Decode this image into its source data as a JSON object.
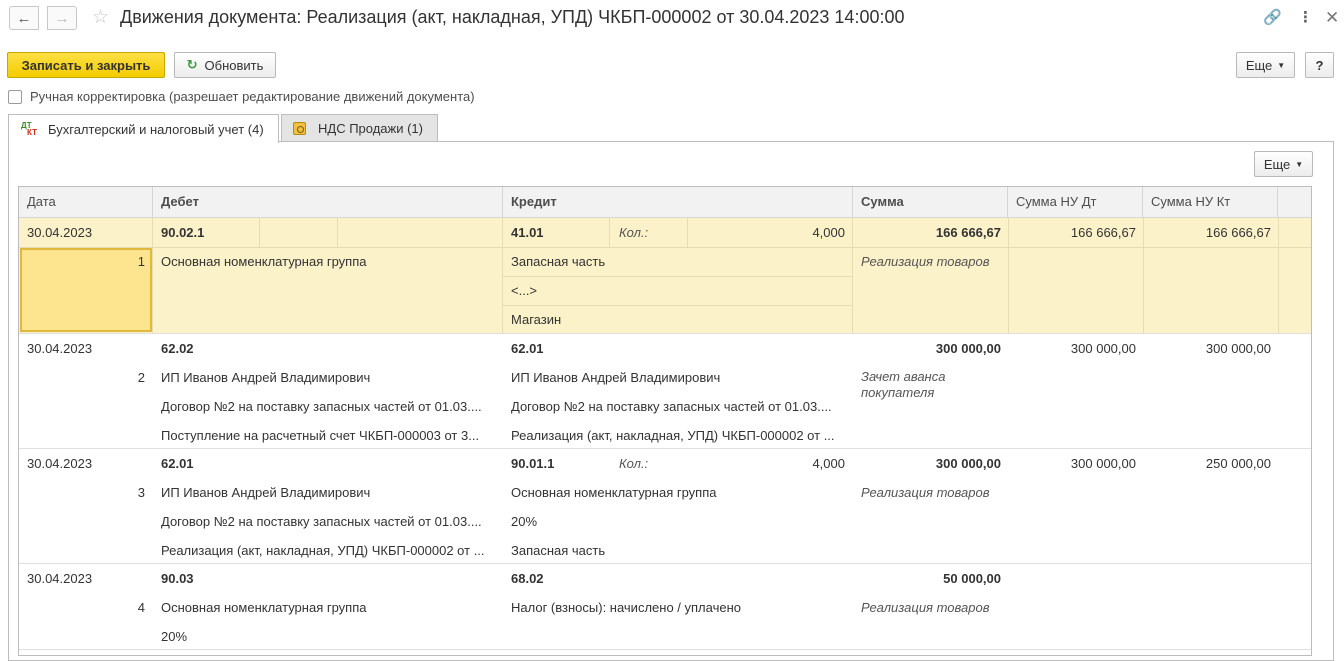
{
  "window": {
    "title": "Движения документа: Реализация (акт, накладная, УПД) ЧКБП-000002 от 30.04.2023 14:00:00",
    "back_icon": "arrow-left-icon",
    "forward_icon": "arrow-right-icon",
    "favorite_icon": "star-icon",
    "link_icon": "link-icon",
    "menu_icon": "kebab-menu-icon",
    "close_icon": "close-icon"
  },
  "toolbar": {
    "save_close_label": "Записать и закрыть",
    "refresh_label": "Обновить",
    "more_label": "Еще",
    "help_label": "?",
    "accent_color": "#f4cc00"
  },
  "manual_checkbox": {
    "label": "Ручная корректировка (разрешает редактирование движений документа)",
    "checked": false
  },
  "tabs": [
    {
      "label": "Бухгалтерский и налоговый учет (4)",
      "active": true,
      "icon": "dt-kt-icon"
    },
    {
      "label": "НДС Продажи (1)",
      "active": false,
      "icon": "vat-register-icon"
    }
  ],
  "panel": {
    "more_label": "Еще"
  },
  "table": {
    "headers": {
      "date": "Дата",
      "debit": "Дебет",
      "credit": "Кредит",
      "sum": "Сумма",
      "sum_nu_dt": "Сумма НУ Дт",
      "sum_nu_kt": "Сумма НУ Кт"
    },
    "records": [
      {
        "date": "30.04.2023",
        "num": "1",
        "debit_account": "90.02.1",
        "debit_lines": [
          "Основная номенклатурная группа",
          "",
          ""
        ],
        "credit_account": "41.01",
        "credit_qty_label": "Кол.:",
        "credit_qty": "4,000",
        "credit_lines": [
          "Запасная часть",
          "<...>",
          "Магазин"
        ],
        "sum": "166 666,67",
        "content": "Реализация товаров",
        "sum_nu_dt": "166 666,67",
        "sum_nu_kt": "166 666,67"
      },
      {
        "date": "30.04.2023",
        "num": "2",
        "debit_account": "62.02",
        "debit_lines": [
          "ИП Иванов Андрей Владимирович",
          "Договор №2 на поставку запасных частей от 01.03....",
          "Поступление на расчетный счет ЧКБП-000003 от 3..."
        ],
        "credit_account": "62.01",
        "credit_qty_label": "",
        "credit_qty": "",
        "credit_lines": [
          "ИП Иванов Андрей Владимирович",
          "Договор №2 на поставку запасных частей от 01.03....",
          "Реализация (акт, накладная, УПД) ЧКБП-000002 от ..."
        ],
        "sum": "300 000,00",
        "content": "Зачет аванса покупателя",
        "sum_nu_dt": "300 000,00",
        "sum_nu_kt": "300 000,00"
      },
      {
        "date": "30.04.2023",
        "num": "3",
        "debit_account": "62.01",
        "debit_lines": [
          "ИП Иванов Андрей Владимирович",
          "Договор №2 на поставку запасных частей от 01.03....",
          "Реализация (акт, накладная, УПД) ЧКБП-000002 от ..."
        ],
        "credit_account": "90.01.1",
        "credit_qty_label": "Кол.:",
        "credit_qty": "4,000",
        "credit_lines": [
          "Основная номенклатурная группа",
          "20%",
          "Запасная часть"
        ],
        "sum": "300 000,00",
        "content": "Реализация товаров",
        "sum_nu_dt": "300 000,00",
        "sum_nu_kt": "250 000,00"
      },
      {
        "date": "30.04.2023",
        "num": "4",
        "debit_account": "90.03",
        "debit_lines": [
          "Основная номенклатурная группа",
          "20%",
          ""
        ],
        "credit_account": "68.02",
        "credit_qty_label": "",
        "credit_qty": "",
        "credit_lines": [
          "Налог (взносы): начислено / уплачено",
          "",
          ""
        ],
        "sum": "50 000,00",
        "content": "Реализация товаров",
        "sum_nu_dt": "",
        "sum_nu_kt": ""
      }
    ]
  }
}
